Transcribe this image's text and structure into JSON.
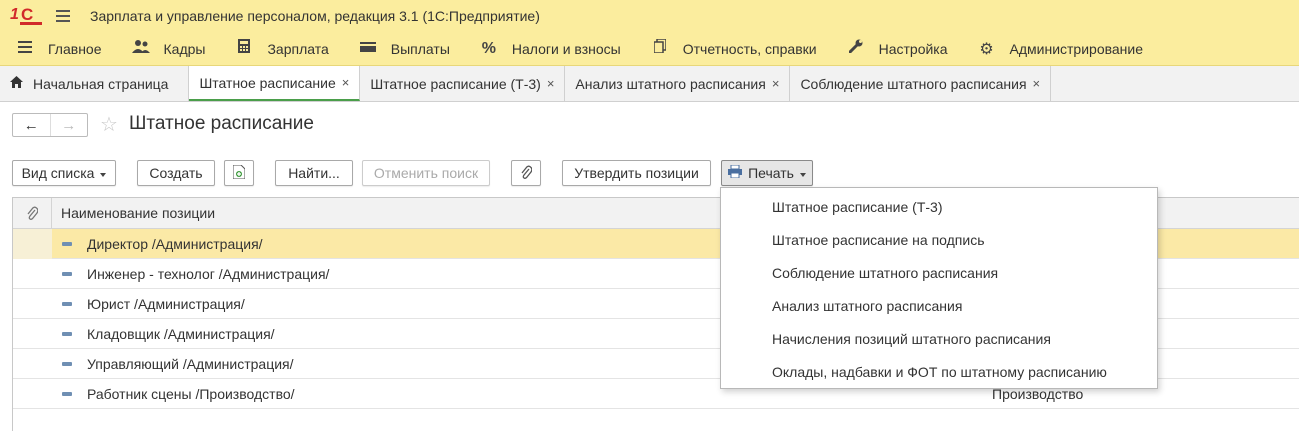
{
  "window": {
    "title": "Зарплата и управление персоналом, редакция 3.1  (1С:Предприятие)",
    "logo_text_one": "1",
    "logo_text_c": "С"
  },
  "sections": [
    {
      "label": "Главное",
      "icon": "menu-icon"
    },
    {
      "label": "Кадры",
      "icon": "people-icon"
    },
    {
      "label": "Зарплата",
      "icon": "calculator-icon"
    },
    {
      "label": "Выплаты",
      "icon": "wallet-icon"
    },
    {
      "label": "Налоги и взносы",
      "icon": "percent-icon"
    },
    {
      "label": "Отчетность, справки",
      "icon": "reports-icon"
    },
    {
      "label": "Настройка",
      "icon": "wrench-icon"
    },
    {
      "label": "Администрирование",
      "icon": "gear-icon"
    }
  ],
  "tabs": [
    {
      "label": "Начальная страница"
    },
    {
      "label": "Штатное расписание",
      "close": "×"
    },
    {
      "label": "Штатное расписание (Т-3)",
      "close": "×"
    },
    {
      "label": "Анализ штатного расписания",
      "close": "×"
    },
    {
      "label": "Соблюдение штатного расписания",
      "close": "×"
    }
  ],
  "form": {
    "title": "Штатное расписание",
    "back": "←",
    "forward": "→",
    "star": "☆"
  },
  "toolbar": {
    "view_list": "Вид списка",
    "create": "Создать",
    "find": "Найти...",
    "cancel_search": "Отменить поиск",
    "approve": "Утвердить позиции",
    "print": "Печать"
  },
  "table": {
    "header_name": "Наименование позиции",
    "rows": [
      {
        "name": "Директор /Администрация/",
        "dept": ""
      },
      {
        "name": "Инженер - технолог /Администрация/",
        "dept": ""
      },
      {
        "name": "Юрист /Администрация/",
        "dept": ""
      },
      {
        "name": "Кладовщик /Администрация/",
        "dept": ""
      },
      {
        "name": "Управляющий /Администрация/",
        "dept": ""
      },
      {
        "name": "Работник сцены /Производство/",
        "dept": "Производство"
      }
    ]
  },
  "print_menu": [
    "Штатное расписание (Т-3)",
    "Штатное расписание на подпись",
    "Соблюдение штатного расписания",
    "Анализ штатного расписания",
    "Начисления позиций штатного расписания",
    "Оклады, надбавки и ФОТ по штатному расписанию"
  ],
  "colors": {
    "titlebar": "#fbed9e",
    "selected_row": "#fbe9a6",
    "active_tab_underline": "#4a9e4a",
    "logo": "#d12a2a"
  }
}
